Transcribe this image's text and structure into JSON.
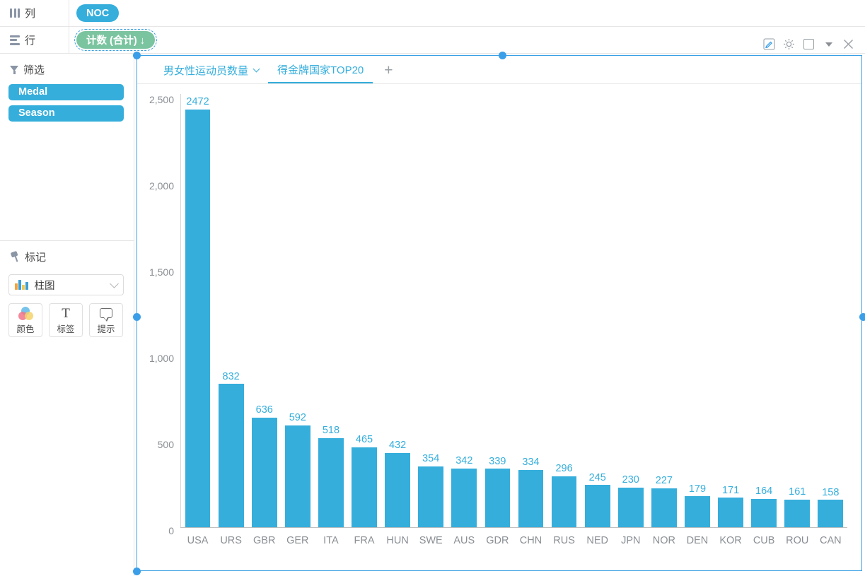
{
  "shelves": [
    {
      "icon": "columns-icon",
      "label": "列",
      "pills": [
        {
          "text": "NOC",
          "color": "#35aedc",
          "style": "blue",
          "selected": false
        }
      ]
    },
    {
      "icon": "rows-icon",
      "label": "行",
      "pills": [
        {
          "text": "计数 (合计) ↓",
          "color": "#7bc4a0",
          "style": "green",
          "selected": true
        }
      ]
    }
  ],
  "sidebar": {
    "filters": {
      "icon": "funnel-icon",
      "title": "筛选",
      "items": [
        {
          "label": "Medal"
        },
        {
          "label": "Season"
        }
      ]
    },
    "marks": {
      "icon": "pin-icon",
      "title": "标记",
      "mark_type": {
        "label": "柱图",
        "icon": "bar-chart-icon",
        "chevron": "chevron-down-icon"
      },
      "buttons": [
        {
          "label": "颜色",
          "icon": "color-circles-icon"
        },
        {
          "label": "标签",
          "icon": "text-t-icon"
        },
        {
          "label": "提示",
          "icon": "tooltip-bubble-icon"
        }
      ]
    }
  },
  "view_toolbar": [
    {
      "name": "edit-icon"
    },
    {
      "name": "gear-icon"
    },
    {
      "name": "square-icon"
    },
    {
      "name": "caret-down-icon"
    },
    {
      "name": "close-icon"
    }
  ],
  "tabs": {
    "items": [
      {
        "label": "男女性运动员数量",
        "active": false,
        "has_chevron": true
      },
      {
        "label": "得金牌国家TOP20",
        "active": true,
        "has_chevron": false
      }
    ],
    "add_label": "+"
  },
  "chart_data": {
    "type": "bar",
    "title": "",
    "xlabel": "",
    "ylabel": "",
    "ylim": [
      0,
      2500
    ],
    "yticks": [
      "0",
      "500",
      "1,000",
      "1,500",
      "2,000",
      "2,500"
    ],
    "ytick_values": [
      0,
      500,
      1000,
      1500,
      2000,
      2500
    ],
    "grid": false,
    "legend": "none",
    "bar_color": "#35aedc",
    "label_color": "#35aedc",
    "categories": [
      "USA",
      "URS",
      "GBR",
      "GER",
      "ITA",
      "FRA",
      "HUN",
      "SWE",
      "AUS",
      "GDR",
      "CHN",
      "RUS",
      "NED",
      "JPN",
      "NOR",
      "DEN",
      "KOR",
      "CUB",
      "ROU",
      "CAN"
    ],
    "values": [
      2472,
      832,
      636,
      592,
      518,
      465,
      432,
      354,
      342,
      339,
      334,
      296,
      245,
      230,
      227,
      179,
      171,
      164,
      161,
      158
    ]
  }
}
